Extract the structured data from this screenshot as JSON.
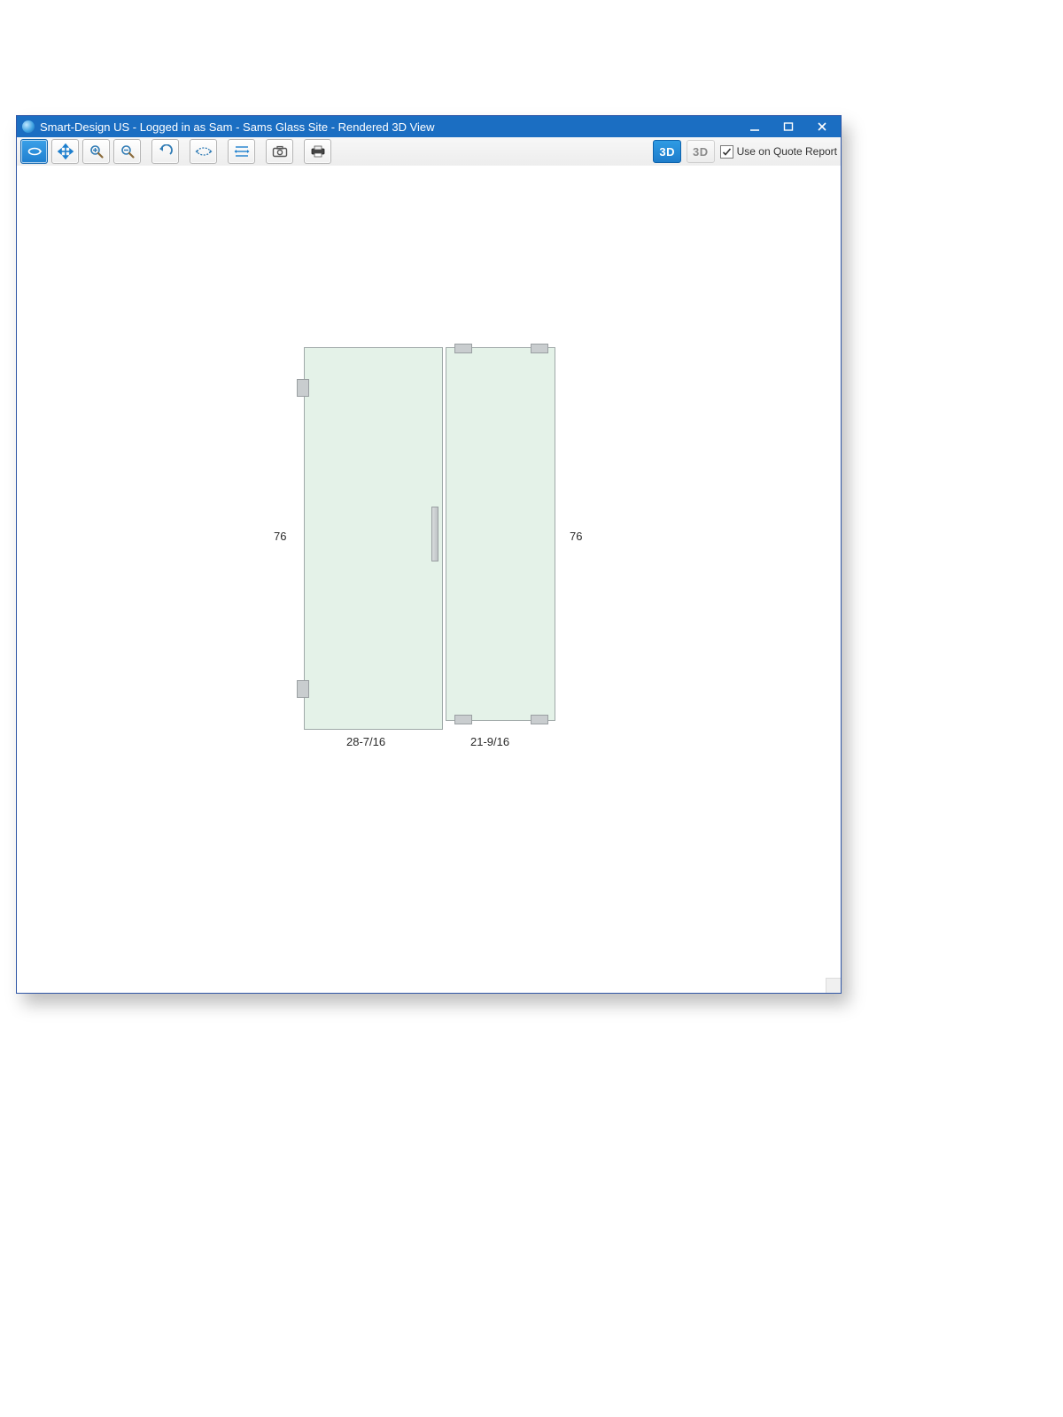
{
  "window": {
    "title": "Smart-Design US - Logged in as Sam - Sams Glass Site - Rendered 3D View"
  },
  "toolbar": {
    "view3d_solid_label": "3D",
    "view3d_wire_label": "3D",
    "use_on_quote_label": "Use on Quote Report",
    "use_on_quote_checked": true,
    "buttons": {
      "rotate": "rotate-icon",
      "pan": "pan-icon",
      "zoom_in": "zoom-in-icon",
      "zoom_out": "zoom-out-icon",
      "undo": "undo-icon",
      "fit": "fit-to-screen-icon",
      "dims": "dimensions-icon",
      "snapshot": "camera-icon",
      "print": "print-icon"
    }
  },
  "dims": {
    "left_height": "76",
    "right_height": "76",
    "door_width": "28-7/16",
    "panel_width": "21-9/16"
  }
}
